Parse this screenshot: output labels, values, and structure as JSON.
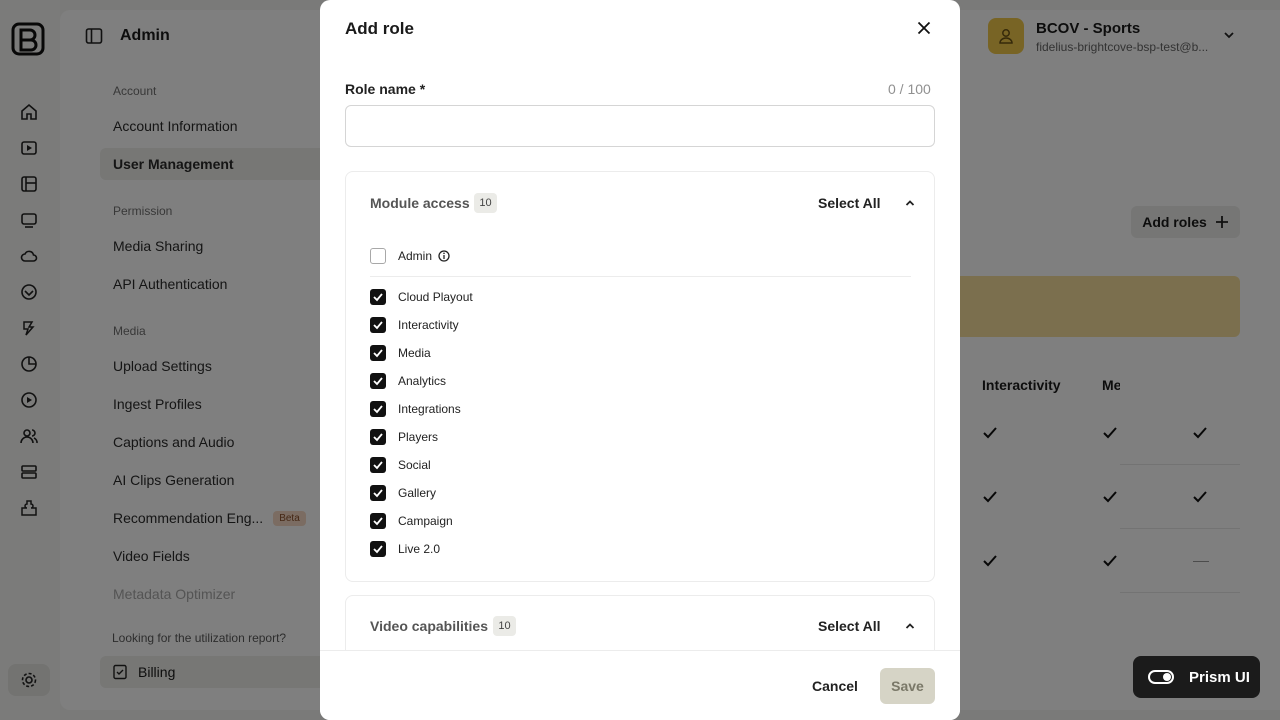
{
  "app": {
    "title": "Admin",
    "sidebar": {
      "sections": [
        {
          "label": "Account",
          "items": [
            "Account Information",
            "User Management"
          ]
        },
        {
          "label": "Permission",
          "items": [
            "Media Sharing",
            "API Authentication"
          ]
        },
        {
          "label": "Media",
          "items": [
            "Upload Settings",
            "Ingest Profiles",
            "Captions and Audio",
            "AI Clips Generation",
            "Recommendation Eng...",
            "Video Fields",
            "Metadata Optimizer"
          ]
        }
      ],
      "beta_badge": "Beta",
      "utilization_prompt": "Looking for the utilization report?",
      "billing_label": "Billing"
    },
    "account": {
      "name": "BCOV - Sports",
      "email": "fidelius-brightcove-bsp-test@b..."
    },
    "roles_page": {
      "add_roles_label": "Add roles",
      "columns": [
        "Interactivity",
        "Me"
      ]
    },
    "prism_label": "Prism UI"
  },
  "modal": {
    "title": "Add role",
    "role_name_label": "Role name *",
    "role_name_count": "0 / 100",
    "role_name_value": "",
    "module_access": {
      "title": "Module access",
      "count": "10",
      "select_all_label": "Select All",
      "admin_label": "Admin",
      "modules": [
        {
          "label": "Cloud Playout",
          "checked": true
        },
        {
          "label": "Interactivity",
          "checked": true
        },
        {
          "label": "Media",
          "checked": true
        },
        {
          "label": "Analytics",
          "checked": true
        },
        {
          "label": "Integrations",
          "checked": true
        },
        {
          "label": "Players",
          "checked": true
        },
        {
          "label": "Social",
          "checked": true
        },
        {
          "label": "Gallery",
          "checked": true
        },
        {
          "label": "Campaign",
          "checked": true
        },
        {
          "label": "Live 2.0",
          "checked": true
        }
      ]
    },
    "video_capabilities": {
      "title": "Video capabilities",
      "count": "10",
      "select_all_label": "Select All"
    },
    "cancel_label": "Cancel",
    "save_label": "Save"
  }
}
